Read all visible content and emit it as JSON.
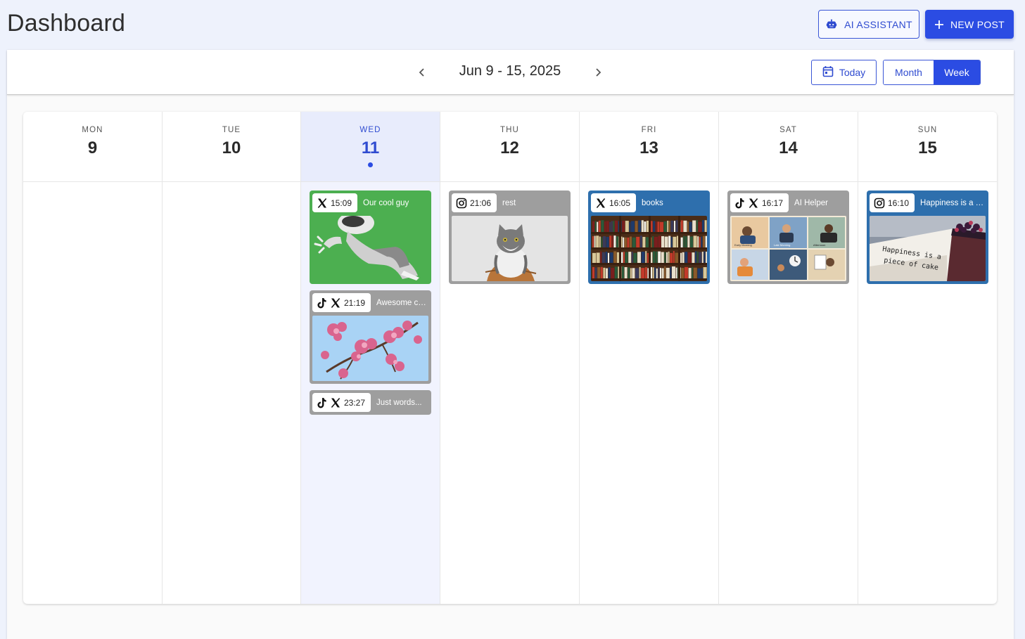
{
  "header": {
    "title": "Dashboard",
    "ai_button": "AI ASSISTANT",
    "new_post_button": "NEW POST"
  },
  "toolbar": {
    "date_range": "Jun 9 - 15, 2025",
    "today_button": "Today",
    "view_month": "Month",
    "view_week": "Week",
    "active_view": "Week"
  },
  "colors": {
    "accent": "#2b4ce3",
    "post_green": "#4caf50",
    "post_grey": "#9e9e9e",
    "post_blue": "#2e6fad"
  },
  "days": [
    {
      "name": "MON",
      "num": "9"
    },
    {
      "name": "TUE",
      "num": "10"
    },
    {
      "name": "WED",
      "num": "11",
      "today": true
    },
    {
      "name": "THU",
      "num": "12"
    },
    {
      "name": "FRI",
      "num": "13"
    },
    {
      "name": "SAT",
      "num": "14"
    },
    {
      "name": "SUN",
      "num": "15"
    }
  ],
  "posts": {
    "wed": [
      {
        "time": "15:09",
        "title": "Our cool guy",
        "platforms": [
          "x-icon"
        ],
        "image": "robot"
      },
      {
        "time": "21:19",
        "title": "Awesome co...",
        "platforms": [
          "tiktok-icon",
          "x-icon"
        ],
        "image": "cherry-blossoms"
      },
      {
        "time": "23:27",
        "title": "Just words...",
        "platforms": [
          "tiktok-icon",
          "x-icon"
        ]
      }
    ],
    "thu": [
      {
        "time": "21:06",
        "title": "rest",
        "platforms": [
          "instagram-icon"
        ],
        "image": "cat"
      }
    ],
    "fri": [
      {
        "time": "16:05",
        "title": "books",
        "platforms": [
          "x-icon"
        ],
        "image": "bookshelf"
      }
    ],
    "sat": [
      {
        "time": "16:17",
        "title": "AI Helper",
        "platforms": [
          "tiktok-icon",
          "x-icon"
        ],
        "image": "comic-panels",
        "panel_labels": [
          "Early Morning",
          "Late Morning",
          "Afternoon"
        ]
      }
    ],
    "sun": [
      {
        "time": "16:10",
        "title": "Happiness is a p...",
        "platforms": [
          "instagram-icon"
        ],
        "image": "cake",
        "image_text": [
          "Happiness is a",
          "piece of cake"
        ]
      }
    ]
  }
}
